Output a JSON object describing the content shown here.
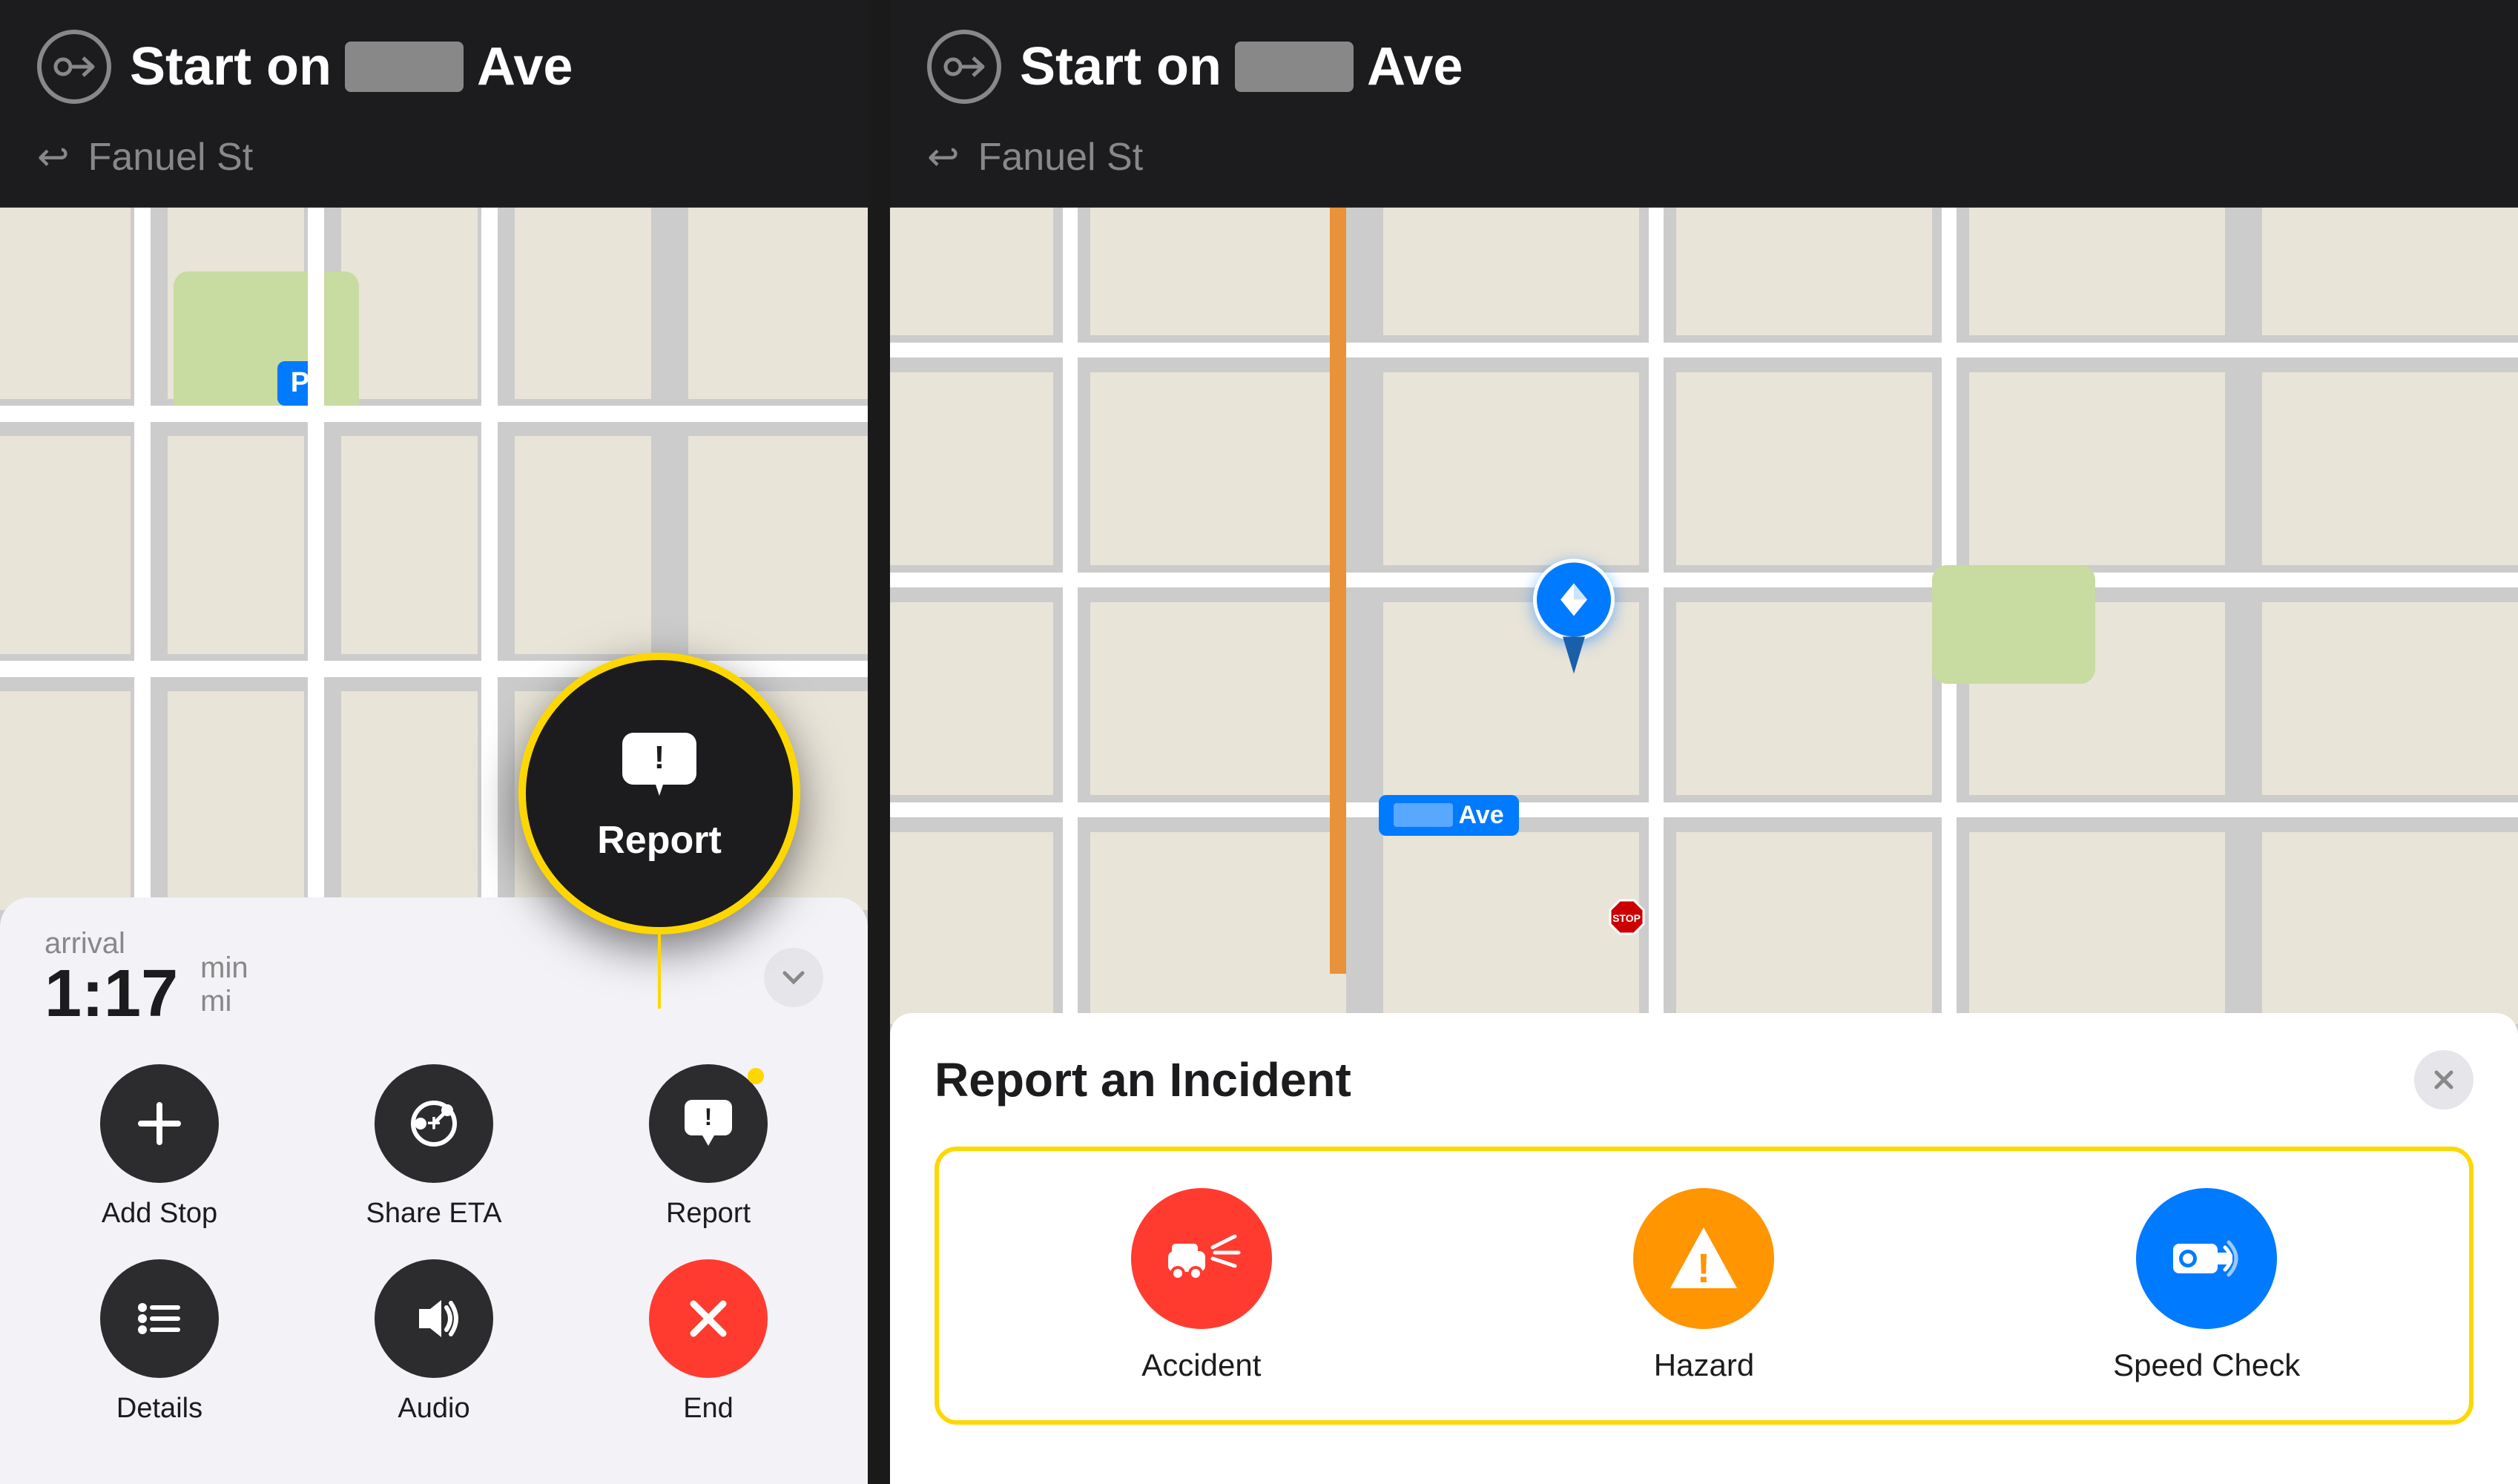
{
  "left_panel": {
    "nav": {
      "start_label": "Start on",
      "street_name": "Ave",
      "sub_street": "Fanuel St"
    },
    "bottom_sheet": {
      "time": "1:17",
      "time_unit": "min",
      "arrival_label": "arrival",
      "buttons": [
        {
          "id": "add-stop",
          "label": "Add Stop",
          "icon": "plus",
          "color": "dark"
        },
        {
          "id": "share-eta",
          "label": "Share ETA",
          "icon": "share-eta",
          "color": "dark"
        },
        {
          "id": "report",
          "label": "Report",
          "icon": "report",
          "color": "dark"
        },
        {
          "id": "details",
          "label": "Details",
          "icon": "list",
          "color": "dark"
        },
        {
          "id": "audio",
          "label": "Audio",
          "icon": "audio",
          "color": "dark"
        },
        {
          "id": "end",
          "label": "End",
          "icon": "x",
          "color": "red"
        }
      ],
      "report_bubble_label": "Report"
    }
  },
  "right_panel": {
    "nav": {
      "start_label": "Start on",
      "street_name": "Ave",
      "sub_street": "Fanuel St"
    },
    "bottom_sheet": {
      "title": "Report an Incident",
      "close_label": "×",
      "incidents": [
        {
          "id": "accident",
          "label": "Accident",
          "color": "red"
        },
        {
          "id": "hazard",
          "label": "Hazard",
          "color": "yellow"
        },
        {
          "id": "speed-check",
          "label": "Speed Check",
          "color": "blue"
        }
      ]
    }
  }
}
